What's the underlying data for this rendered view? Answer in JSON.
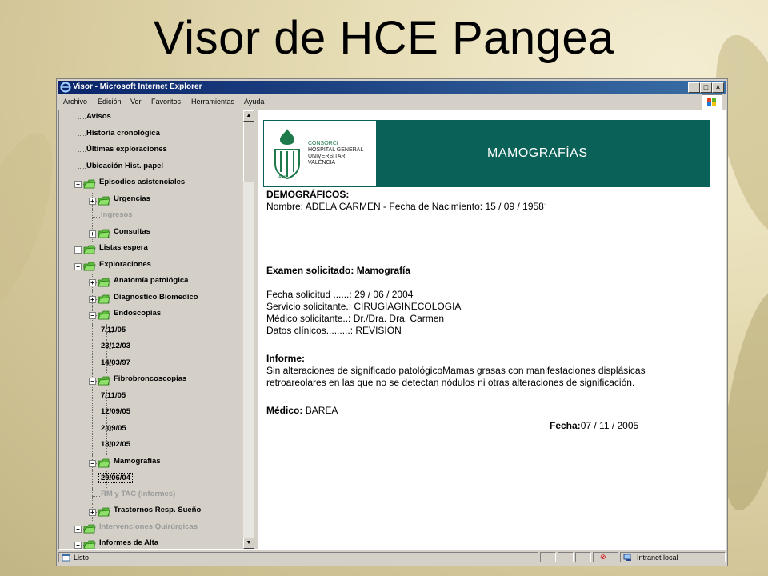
{
  "slide": {
    "title": "Visor de HCE Pangea"
  },
  "window": {
    "title": "Visor - Microsoft Internet Explorer",
    "buttons": {
      "minimize": "_",
      "maximize": "□",
      "close": "×"
    }
  },
  "menu": [
    "Archivo",
    "Edición",
    "Ver",
    "Favoritos",
    "Herramientas",
    "Ayuda"
  ],
  "tree": [
    {
      "label": "Avisos",
      "level": 0,
      "icon": "none",
      "toggle": "none",
      "dim": false
    },
    {
      "label": "Historia cronológica",
      "level": 0,
      "icon": "none",
      "toggle": "none",
      "dim": false
    },
    {
      "label": "Últimas exploraciones",
      "level": 0,
      "icon": "none",
      "toggle": "none",
      "dim": false
    },
    {
      "label": "Ubicación Hist. papel",
      "level": 0,
      "icon": "none",
      "toggle": "none",
      "dim": false
    },
    {
      "label": "Episodios asistenciales",
      "level": 0,
      "icon": "folder",
      "toggle": "minus",
      "dim": false
    },
    {
      "label": "Urgencias",
      "level": 1,
      "icon": "folder",
      "toggle": "plus",
      "dim": false
    },
    {
      "label": "Ingresos",
      "level": 1,
      "icon": "none",
      "toggle": "none",
      "dim": true
    },
    {
      "label": "Consultas",
      "level": 1,
      "icon": "folder",
      "toggle": "plus",
      "dim": false
    },
    {
      "label": "Listas espera",
      "level": 0,
      "icon": "folder",
      "toggle": "plus",
      "dim": false
    },
    {
      "label": "Exploraciones",
      "level": 0,
      "icon": "folder",
      "toggle": "minus",
      "dim": false
    },
    {
      "label": "Anatomía patológica",
      "level": 1,
      "icon": "folder",
      "toggle": "plus",
      "dim": false
    },
    {
      "label": "Diagnostico Biomedico",
      "level": 1,
      "icon": "folder",
      "toggle": "plus",
      "dim": false
    },
    {
      "label": "Endoscopias",
      "level": 1,
      "icon": "folder",
      "toggle": "minus",
      "dim": false
    },
    {
      "label": "7/11/05",
      "level": 2,
      "icon": "none",
      "toggle": "none",
      "dim": false
    },
    {
      "label": "23/12/03",
      "level": 2,
      "icon": "none",
      "toggle": "none",
      "dim": false
    },
    {
      "label": "14/03/97",
      "level": 2,
      "icon": "none",
      "toggle": "none",
      "dim": false
    },
    {
      "label": "Fibrobroncoscopias",
      "level": 1,
      "icon": "folder",
      "toggle": "minus",
      "dim": false
    },
    {
      "label": "7/11/05",
      "level": 2,
      "icon": "none",
      "toggle": "none",
      "dim": false
    },
    {
      "label": "12/09/05",
      "level": 2,
      "icon": "none",
      "toggle": "none",
      "dim": false
    },
    {
      "label": "2/09/05",
      "level": 2,
      "icon": "none",
      "toggle": "none",
      "dim": false
    },
    {
      "label": "18/02/05",
      "level": 2,
      "icon": "none",
      "toggle": "none",
      "dim": false
    },
    {
      "label": "Mamografias",
      "level": 1,
      "icon": "folder",
      "toggle": "minus",
      "dim": false
    },
    {
      "label": "29/06/04",
      "level": 2,
      "icon": "none",
      "toggle": "none",
      "dim": false,
      "selected": true
    },
    {
      "label": "RM y TAC (Informes)",
      "level": 1,
      "icon": "none",
      "toggle": "none",
      "dim": true
    },
    {
      "label": "Trastornos Resp. Sueño",
      "level": 1,
      "icon": "folder",
      "toggle": "plus",
      "dim": false
    },
    {
      "label": "Intervenciones Quirúrgicas",
      "level": 0,
      "icon": "folder",
      "toggle": "plus",
      "dim": true
    },
    {
      "label": "Informes de Alta",
      "level": 0,
      "icon": "folder",
      "toggle": "plus",
      "dim": false
    }
  ],
  "report": {
    "logo": {
      "line1": "CONSORCI",
      "lines": [
        "HOSPITAL GENERAL",
        "UNIVERSITARI",
        "VALÈNCIA"
      ],
      "tag": "ARS"
    },
    "banner_title": "MAMOGRAFÍAS",
    "demographics": {
      "heading": "DEMOGRÁFICOS:",
      "name_label": "Nombre:",
      "name_value": "ADELA  CARMEN",
      "dob_label": " - Fecha de Nacimiento:",
      "dob_value": "15 / 09 / 1958",
      "dob_suffix": "·"
    },
    "exam": {
      "label": "Examen solicitado:",
      "value": "Mamografía"
    },
    "fields": [
      {
        "label": "Fecha solicitud ......:",
        "value": "29 / 06 / 2004"
      },
      {
        "label": "Servicio solicitante.:",
        "value": "CIRUGIAGINECOLOGIA"
      },
      {
        "label": "Médico solicitante..:",
        "value": "Dr./Dra. Dra. Carmen"
      },
      {
        "label": "Datos clínicos.........:",
        "value": "REVISION"
      }
    ],
    "informe": {
      "heading": "Informe:",
      "line1": "Sin alteraciones de significado patológicoMamas grasas con manifestaciones displásicas",
      "line2": "retroareolares en las que no se detectan nódulos ni otras alteraciones de significación."
    },
    "doctor": {
      "label": "Médico:",
      "value": "BAREA"
    },
    "date": {
      "label": "Fecha:",
      "value": "07 / 11 / 2005"
    }
  },
  "status": {
    "text": "Listo",
    "zone": "Intranet local"
  }
}
